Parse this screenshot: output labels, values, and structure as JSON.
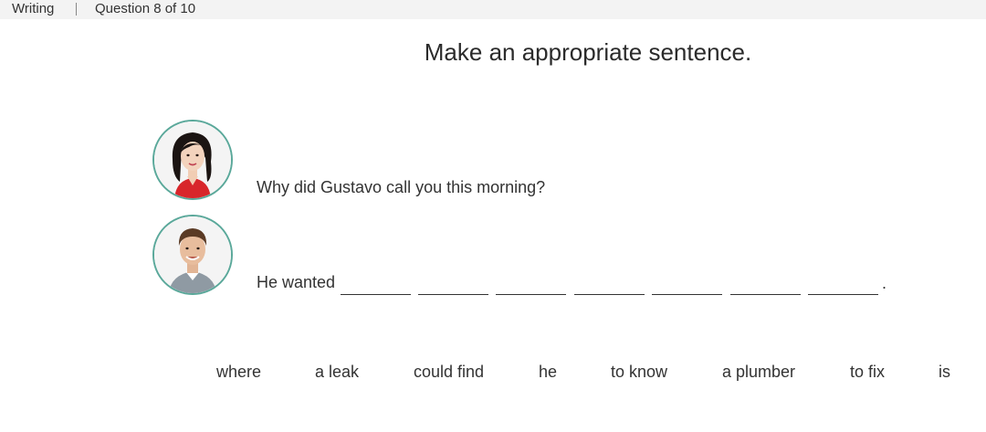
{
  "header": {
    "section": "Writing",
    "progress": "Question 8 of 10"
  },
  "instruction": "Make an appropriate sentence.",
  "dialogue": {
    "speaker1": {
      "avatar": "woman-avatar",
      "text": "Why did Gustavo call you this morning?"
    },
    "speaker2": {
      "avatar": "man-avatar",
      "prefix": "He wanted",
      "blank_count": 7,
      "ending": "."
    }
  },
  "word_bank": [
    "where",
    "a leak",
    "could find",
    "he",
    "to know",
    "a plumber",
    "to fix",
    "is"
  ],
  "colors": {
    "avatar_ring": "#5aa89a",
    "topbar_bg": "#f3f3f3",
    "text": "#333333"
  }
}
